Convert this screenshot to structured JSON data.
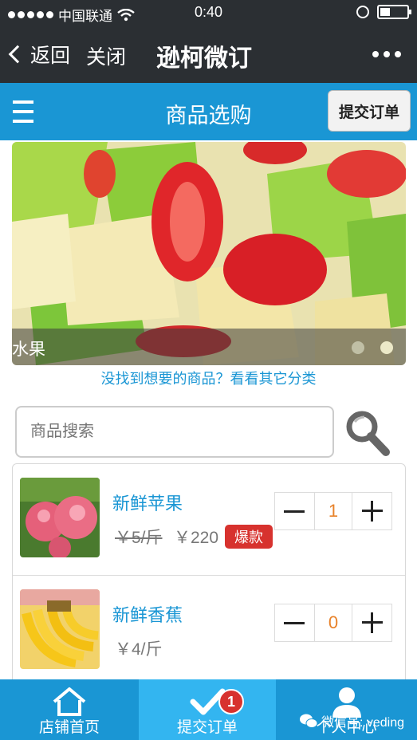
{
  "status": {
    "carrier": "中国联通",
    "time": "0:40"
  },
  "nav": {
    "back": "返回",
    "close": "关闭",
    "title": "逊柯微订"
  },
  "page": {
    "title": "商品选购",
    "submit": "提交订单"
  },
  "banner": {
    "label": "水果",
    "slides": 2,
    "active_index": 1
  },
  "other_category_link": "没找到想要的商品？看看其它分类",
  "search": {
    "placeholder": "商品搜索"
  },
  "products": [
    {
      "name": "新鲜苹果",
      "old_price": "￥5/斤",
      "price": "￥220",
      "tag": "爆款",
      "qty": "1",
      "image": "apple-photo"
    },
    {
      "name": "新鲜香蕉",
      "price": "￥4/斤",
      "qty": "0",
      "image": "banana-photo"
    }
  ],
  "tabs": [
    {
      "label": "店铺首页",
      "icon": "home-icon"
    },
    {
      "label": "提交订单",
      "icon": "check-icon",
      "badge": "1",
      "active": true
    },
    {
      "label": "个人中心",
      "icon": "user-icon"
    }
  ],
  "watermark": "微信号: veding",
  "colors": {
    "brand_blue": "#1a96d4",
    "dark_header": "#2b2f33",
    "hot_red": "#d7322e",
    "qty_orange": "#e8822a"
  }
}
